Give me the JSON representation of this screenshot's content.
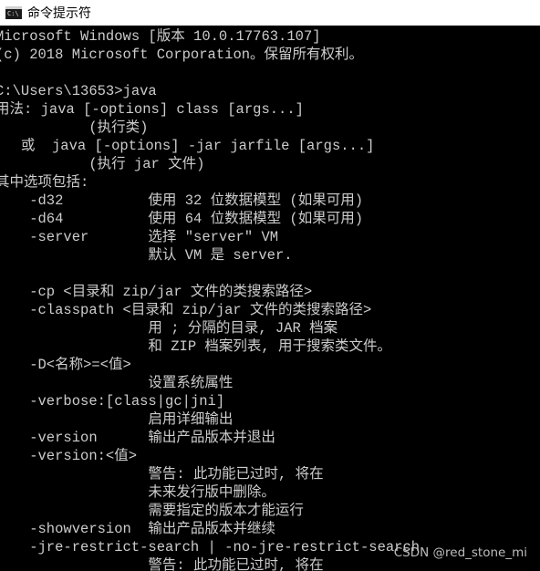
{
  "window": {
    "icon_glyph": "C:\\",
    "title": "命令提示符"
  },
  "console": {
    "lines": [
      "Microsoft Windows [版本 10.0.17763.107]",
      "(c) 2018 Microsoft Corporation。保留所有权利。",
      "",
      "C:\\Users\\13653>java",
      "用法: java [-options] class [args...]",
      "           (执行类)",
      "   或  java [-options] -jar jarfile [args...]",
      "           (执行 jar 文件)",
      "其中选项包括:",
      "    -d32          使用 32 位数据模型 (如果可用)",
      "    -d64          使用 64 位数据模型 (如果可用)",
      "    -server       选择 \"server\" VM",
      "                  默认 VM 是 server.",
      "",
      "    -cp <目录和 zip/jar 文件的类搜索路径>",
      "    -classpath <目录和 zip/jar 文件的类搜索路径>",
      "                  用 ; 分隔的目录, JAR 档案",
      "                  和 ZIP 档案列表, 用于搜索类文件。",
      "    -D<名称>=<值>",
      "                  设置系统属性",
      "    -verbose:[class|gc|jni]",
      "                  启用详细输出",
      "    -version      输出产品版本并退出",
      "    -version:<值>",
      "                  警告: 此功能已过时, 将在",
      "                  未来发行版中删除。",
      "                  需要指定的版本才能运行",
      "    -showversion  输出产品版本并继续",
      "    -jre-restrict-search | -no-jre-restrict-search",
      "                  警告: 此功能已过时, 将在"
    ]
  },
  "watermark": "CSDN @red_stone_mi",
  "colors": {
    "console_background": "#000000",
    "console_text": "#cccccc",
    "titlebar_background": "#ffffff"
  }
}
